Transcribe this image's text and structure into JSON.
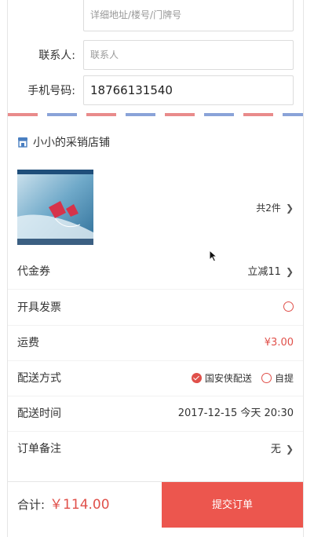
{
  "address": {
    "detail_placeholder": "详细地址/楼号/门牌号",
    "contact_label": "联系人:",
    "contact_placeholder": "联系人",
    "phone_label": "手机号码:",
    "phone_value": "18766131540"
  },
  "shop": {
    "name": "小小的采销店铺",
    "item_count": "共2件"
  },
  "rows": {
    "coupon": {
      "label": "代金券",
      "value": "立减11"
    },
    "invoice": {
      "label": "开具发票"
    },
    "shipping_fee": {
      "label": "运费",
      "value": "¥3.00"
    },
    "delivery": {
      "label": "配送方式",
      "options": [
        "国安侠配送",
        "自提"
      ],
      "selected": "国安侠配送"
    },
    "delivery_time": {
      "label": "配送时间",
      "value": "2017-12-15 今天 20:30"
    },
    "note": {
      "label": "订单备注",
      "value": "无"
    }
  },
  "footer": {
    "total_label": "合计:",
    "total_value": "￥114.00",
    "submit_label": "提交订单"
  },
  "colors": {
    "accent": "#ec564e",
    "price": "#e0504a",
    "shop_icon": "#4a7fc1"
  }
}
